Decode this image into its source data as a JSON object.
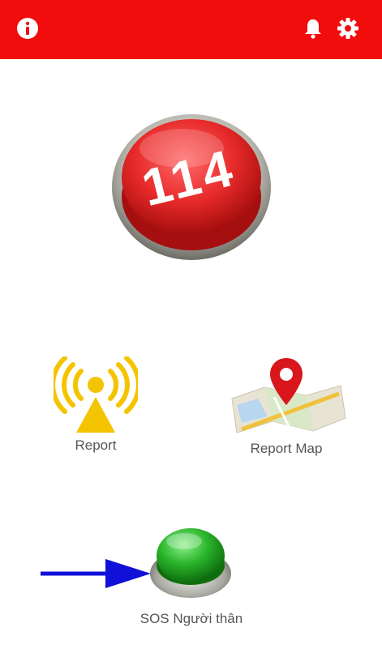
{
  "header": {
    "background_color": "#f20d0d",
    "left_icon": "info-icon",
    "right_icons": [
      "bell-icon",
      "gear-icon"
    ]
  },
  "emergency_button": {
    "label": "114",
    "color": "#e82a2a"
  },
  "actions": {
    "report": {
      "label": "Report",
      "icon": "broadcast-icon",
      "color": "#f5c400"
    },
    "report_map": {
      "label": "Report Map",
      "icon": "map-pin-icon"
    }
  },
  "sos": {
    "label": "SOS Người thân",
    "color": "#2bb52b"
  },
  "annotation": {
    "arrow_color": "#1010d8",
    "icon": "arrow-right-icon"
  }
}
